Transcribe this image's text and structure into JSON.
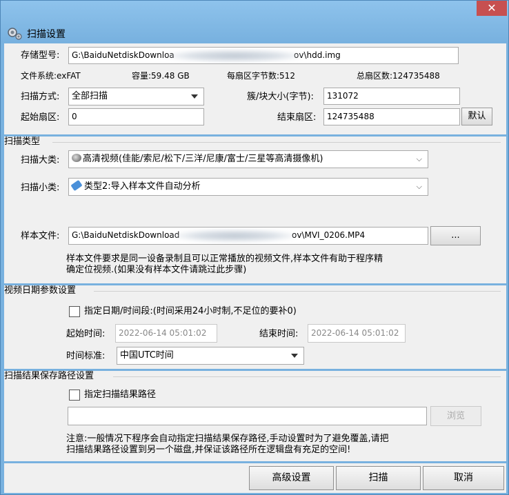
{
  "title": "扫描设置",
  "close_label": "✕",
  "storage": {
    "label": "存储型号:",
    "path_start": "G:\\BaiduNetdiskDownloa",
    "path_end": "ov\\hdd.img",
    "fs_label": "文件系统:",
    "fs_value": "exFAT",
    "cap_label": "容量:",
    "cap_value": "59.48 GB",
    "sector_label": "每扇区字节数:",
    "sector_value": "512",
    "total_label": "总扇区数:",
    "total_value": "124735488",
    "scan_mode_label": "扫描方式:",
    "scan_mode_value": "全部扫描",
    "cluster_label": "簇/块大小(字节):",
    "cluster_value": "131072",
    "start_sector_label": "起始扇区:",
    "start_sector_value": "0",
    "end_sector_label": "结束扇区:",
    "end_sector_value": "124735488",
    "default_button": "默认"
  },
  "scan_type": {
    "group_title": "扫描类型",
    "category_label": "扫描大类:",
    "category_value": "高清视频(佳能/索尼/松下/三洋/尼康/富士/三星等高清摄像机)",
    "subcategory_label": "扫描小类:",
    "subcategory_value": "类型2:导入样本文件自动分析",
    "sample_label": "样本文件:",
    "sample_path_start": "G:\\BaiduNetdiskDownload",
    "sample_path_end": "ov\\MVI_0206.MP4",
    "browse_dots": "...",
    "note_line1": "样本文件要求是同一设备录制且可以正常播放的视频文件,样本文件有助于程序精",
    "note_line2": "确定位视频.(如果没有样本文件请跳过此步骤)"
  },
  "date_params": {
    "group_title": "视频日期参数设置",
    "checkbox_label": "指定日期/时间段:(时间采用24小时制,不足位的要补0)",
    "start_label": "起始时间:",
    "start_value": "2022-06-14 05:01:02",
    "end_label": "结束时间:",
    "end_value": "2022-06-14 05:01:02",
    "tz_label": "时间标准:",
    "tz_value": "中国UTC时间"
  },
  "result_path": {
    "group_title": "扫描结果保存路径设置",
    "checkbox_label": "指定扫描结果路径",
    "path_value": "",
    "browse_button": "浏览",
    "note_line1": "注意:一般情况下程序会自动指定扫描结果保存路径,手动设置时为了避免覆盖,请把",
    "note_line2": "扫描结果路径设置到另一个磁盘,并保证该路径所在逻辑盘有充足的空间!"
  },
  "footer": {
    "advanced_button": "高级设置",
    "scan_button": "扫描",
    "cancel_button": "取消"
  }
}
